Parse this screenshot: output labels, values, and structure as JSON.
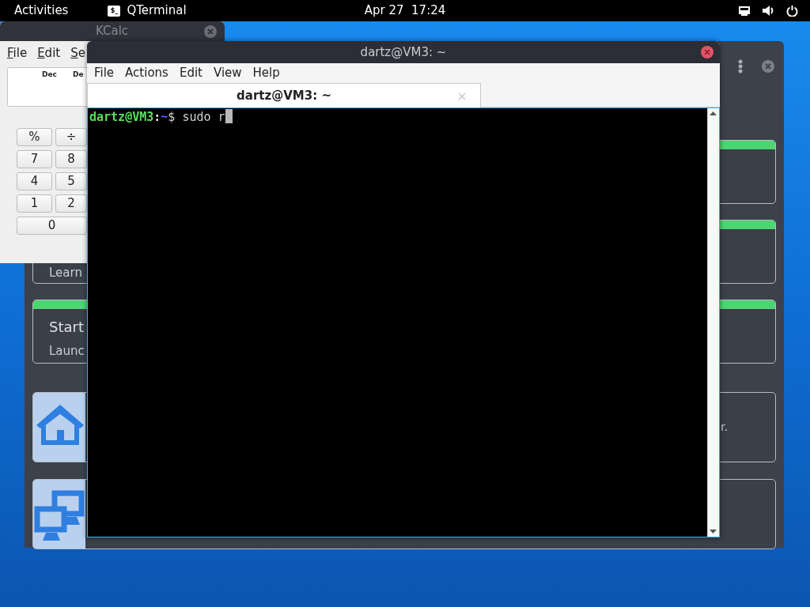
{
  "top_bar": {
    "activities": "Activities",
    "app_icon_glyph": "$_",
    "app_name": "QTerminal",
    "date": "Apr 27",
    "time": "17:24"
  },
  "welcome_window": {
    "cards": [
      {
        "kind": "banner"
      },
      {
        "kind": "banner",
        "subtitle": "Learn"
      },
      {
        "kind": "banner",
        "title": "Start",
        "subtitle": "Launc"
      },
      {
        "kind": "tile",
        "text": "r."
      },
      {
        "kind": "tile"
      }
    ]
  },
  "kcalc": {
    "title": "KCalc",
    "active": false,
    "menu": [
      "File",
      "Edit",
      "Se"
    ],
    "display_labels": [
      "Dec",
      "De"
    ],
    "keys": [
      [
        "%",
        "÷"
      ],
      [
        "7",
        "8"
      ],
      [
        "4",
        "5"
      ],
      [
        "1",
        "2"
      ],
      [
        "0"
      ]
    ]
  },
  "terminal": {
    "title": "dartz@VM3: ~",
    "active": true,
    "menu": [
      "File",
      "Actions",
      "Edit",
      "View",
      "Help"
    ],
    "tabs": [
      {
        "label": "dartz@VM3: ~",
        "selected": true
      }
    ],
    "prompt": {
      "user_host": "dartz@VM3",
      "separator": ":",
      "path": "~",
      "symbol": "$",
      "command": "sudo r"
    }
  }
}
